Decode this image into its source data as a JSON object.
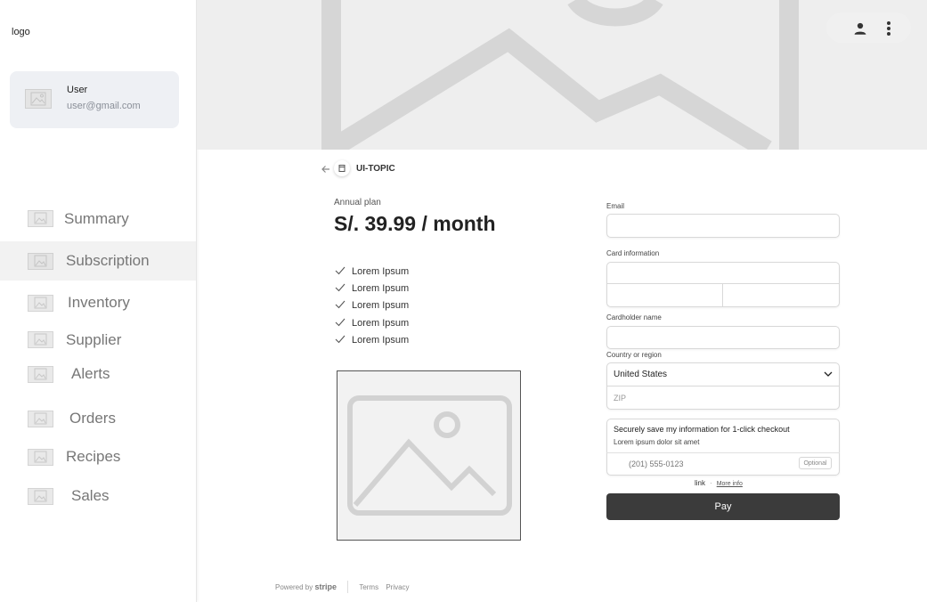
{
  "sidebar": {
    "logo": "logo",
    "user": {
      "name": "User",
      "email": "user@gmail.com"
    },
    "items": [
      {
        "label": "Summary"
      },
      {
        "label": "Subscription"
      },
      {
        "label": "Inventory"
      },
      {
        "label": "Supplier"
      },
      {
        "label": "Alerts"
      },
      {
        "label": "Orders"
      },
      {
        "label": "Recipes"
      },
      {
        "label": "Sales"
      }
    ],
    "active_item": "Subscription"
  },
  "header": {
    "icons": [
      "hero-image-placeholder",
      "user-icon",
      "more-vert-icon"
    ]
  },
  "checkout": {
    "breadcrumb": {
      "title": "UI-TOPIC"
    },
    "plan": {
      "name": "Annual plan",
      "price": "S/. 39.99 / month"
    },
    "features": [
      "Lorem Ipsum",
      "Lorem Ipsum",
      "Lorem Ipsum",
      "Lorem Ipsum",
      "Lorem Ipsum"
    ],
    "form": {
      "email_label": "Email",
      "email_value": "",
      "card_label": "Card information",
      "card_number_value": "",
      "card_expiry_value": "",
      "card_cvc_value": "",
      "cardholder_label": "Cardholder name",
      "cardholder_value": "",
      "country_label": "Country or region",
      "country_value": "United States",
      "zip_placeholder": "ZIP",
      "save_title": "Securely save my information for 1-click checkout",
      "save_subtitle": "Lorem ipsum dolor sit amet",
      "phone_placeholder": "(201) 555-0123",
      "optional_badge": "Optional",
      "link_brand": "link",
      "link_more": "More info",
      "pay_label": "Pay"
    },
    "footer": {
      "powered_by": "Powered by",
      "brand": "stripe",
      "terms": "Terms",
      "privacy": "Privacy"
    }
  },
  "colors": {
    "sidebar_active_bg": "#f2f2f2",
    "user_card_bg": "#eef0f4",
    "hero_bg": "#eeeeee",
    "pay_button_bg": "#3b3b3b"
  }
}
